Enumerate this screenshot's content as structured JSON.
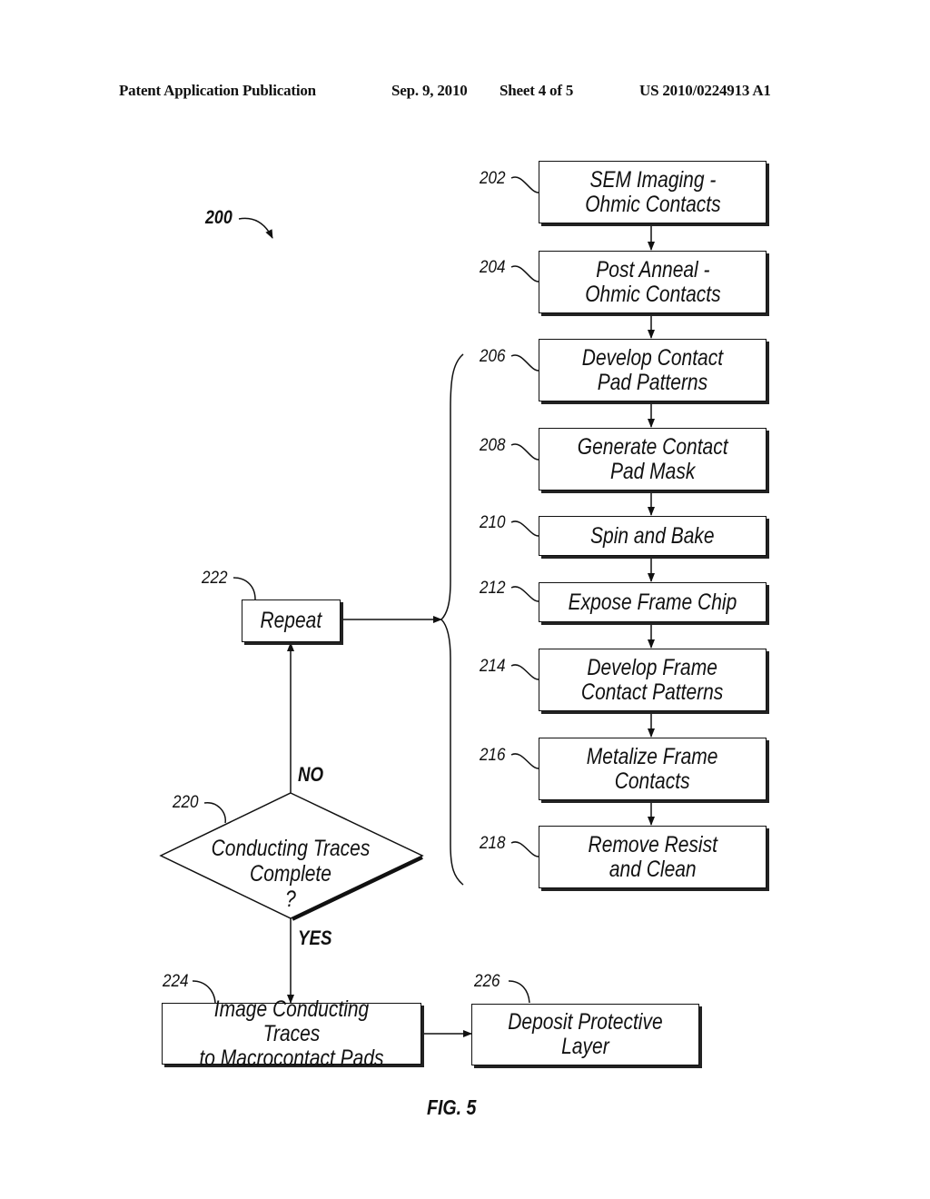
{
  "header": {
    "publication_type": "Patent Application Publication",
    "date": "Sep. 9, 2010",
    "sheet": "Sheet 4 of 5",
    "patent_number": "US 2010/0224913 A1"
  },
  "figure": {
    "reference": "200",
    "caption": "FIG. 5"
  },
  "steps": [
    {
      "ref": "202",
      "label": "SEM Imaging -\nOhmic Contacts"
    },
    {
      "ref": "204",
      "label": "Post Anneal -\nOhmic Contacts"
    },
    {
      "ref": "206",
      "label": "Develop Contact\nPad Patterns"
    },
    {
      "ref": "208",
      "label": "Generate Contact\nPad Mask"
    },
    {
      "ref": "210",
      "label": "Spin and Bake"
    },
    {
      "ref": "212",
      "label": "Expose Frame Chip"
    },
    {
      "ref": "214",
      "label": "Develop Frame\nContact Patterns"
    },
    {
      "ref": "216",
      "label": "Metalize Frame\nContacts"
    },
    {
      "ref": "218",
      "label": "Remove Resist\nand Clean"
    }
  ],
  "repeat": {
    "ref": "222",
    "label": "Repeat"
  },
  "decision": {
    "ref": "220",
    "label": "Conducting Traces\nComplete\n?",
    "no_label": "NO",
    "yes_label": "YES"
  },
  "final_steps": [
    {
      "ref": "224",
      "label": "Image Conducting Traces\nto Macrocontact Pads"
    },
    {
      "ref": "226",
      "label": "Deposit Protective\nLayer"
    }
  ]
}
